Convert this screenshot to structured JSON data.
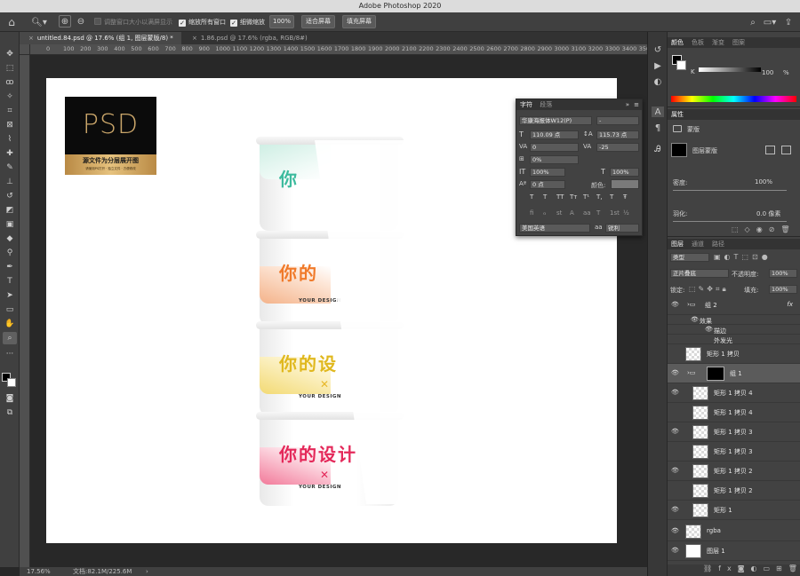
{
  "app": {
    "title": "Adobe Photoshop 2020"
  },
  "options": {
    "check1": "调整窗口大小以满屏显示",
    "check2": "缩放所有窗口",
    "check3": "细微缩放",
    "zoom": "100%",
    "fit_screen": "适合屏幕",
    "fill_screen": "填充屏幕"
  },
  "tabs": [
    {
      "label": "untitled.84.psd @ 17.6% (组 1, 图层蒙版/8) *"
    },
    {
      "label": "1.86.psd @ 17.6% (rgba, RGB/8#)"
    }
  ],
  "ruler": {
    "h_labels": [
      "0",
      "100",
      "200",
      "300",
      "400",
      "500",
      "600",
      "700",
      "800",
      "900",
      "1000",
      "1100",
      "1200",
      "1300",
      "1400",
      "1500",
      "1600",
      "1700",
      "1800",
      "1900",
      "2000",
      "2100",
      "2200",
      "2300",
      "2400",
      "2500",
      "2600",
      "2700",
      "2800",
      "2900",
      "3000",
      "3100",
      "3200",
      "3300",
      "3400",
      "3500",
      "3600"
    ]
  },
  "status": {
    "zoom": "17.56%",
    "doc": "文档:82.1M/225.6M"
  },
  "canvas": {
    "psd_label": "PSD",
    "psd_caption": "源文件为分层展开图",
    "psd_subcaption": "请使用PS打开 · 独立文件 · 方便修改",
    "cup_text": "你的设计",
    "cup_brand": "YOUR DESIGN",
    "cups": [
      {
        "text": "你",
        "color": "#3dbb9e",
        "accent": "#bfe7da"
      },
      {
        "text": "你的",
        "color": "#f07a2a",
        "accent": "#f6c2a2"
      },
      {
        "text": "你的设",
        "color": "#e0b81e",
        "accent": "#f5e39a"
      },
      {
        "text": "你的设计",
        "color": "#e4295a",
        "accent": "#f7a9bd"
      }
    ]
  },
  "char_panel": {
    "tabs": [
      "字符",
      "段落"
    ],
    "font": "华康海报体W12(P)",
    "font_style": "-",
    "size": "110.09 点",
    "leading": "115.73 点",
    "kerning": "0",
    "tracking": "-25",
    "scale_percent": "0%",
    "v_scale": "100%",
    "h_scale": "100%",
    "baseline": "0 点",
    "color_label": "颜色:",
    "style_buttons": [
      "T",
      "T",
      "TT",
      "Tт",
      "T¹",
      "T,",
      "T",
      "Ŧ"
    ],
    "ot_buttons": [
      "fi",
      "ℴ",
      "st",
      "A",
      "aa",
      "T",
      "1st",
      "½"
    ],
    "language": "美国英语",
    "aa_label": "aa",
    "aa_value": "锐利"
  },
  "color_panel": {
    "tabs": [
      "颜色",
      "色板",
      "渐变",
      "图案"
    ],
    "k_label": "K",
    "k_value": "100",
    "pct": "%"
  },
  "props_panel": {
    "tab": "属性",
    "mask_label": "蒙版",
    "layer_mask_label": "图层蒙版",
    "density_label": "密度:",
    "density_value": "100%",
    "feather_label": "羽化:",
    "feather_value": "0.0 像素"
  },
  "layers_panel": {
    "tabs": [
      "图层",
      "通道",
      "路径"
    ],
    "filter_kind": "类型",
    "blend": "正片叠底",
    "opacity_label": "不透明度:",
    "opacity": "100%",
    "lock_label": "锁定:",
    "fill_label": "填充:",
    "fill": "100%",
    "layers": [
      {
        "name": "组 2",
        "type": "group",
        "visible": true
      },
      {
        "name": "效果",
        "type": "fx",
        "visible": true
      },
      {
        "name": "描边",
        "type": "fx",
        "visible": true
      },
      {
        "name": "外发光",
        "type": "fx",
        "visible": false
      },
      {
        "name": "矩形 1 拷贝",
        "type": "layer",
        "visible": false
      },
      {
        "name": "组 1",
        "type": "group",
        "visible": true,
        "selected": true
      },
      {
        "name": "矩形 1 拷贝 4",
        "type": "layer",
        "visible": true
      },
      {
        "name": "矩形 1 拷贝 4",
        "type": "layer",
        "visible": false
      },
      {
        "name": "矩形 1 拷贝 3",
        "type": "layer",
        "visible": true
      },
      {
        "name": "矩形 1 拷贝 3",
        "type": "layer",
        "visible": false
      },
      {
        "name": "矩形 1 拷贝 2",
        "type": "layer",
        "visible": true
      },
      {
        "name": "矩形 1 拷贝 2",
        "type": "layer",
        "visible": false
      },
      {
        "name": "矩形 1",
        "type": "layer",
        "visible": true
      },
      {
        "name": "rgba",
        "type": "layer",
        "visible": true
      },
      {
        "name": "图层 1",
        "type": "layer",
        "visible": true
      }
    ],
    "fx_label": "fx"
  }
}
